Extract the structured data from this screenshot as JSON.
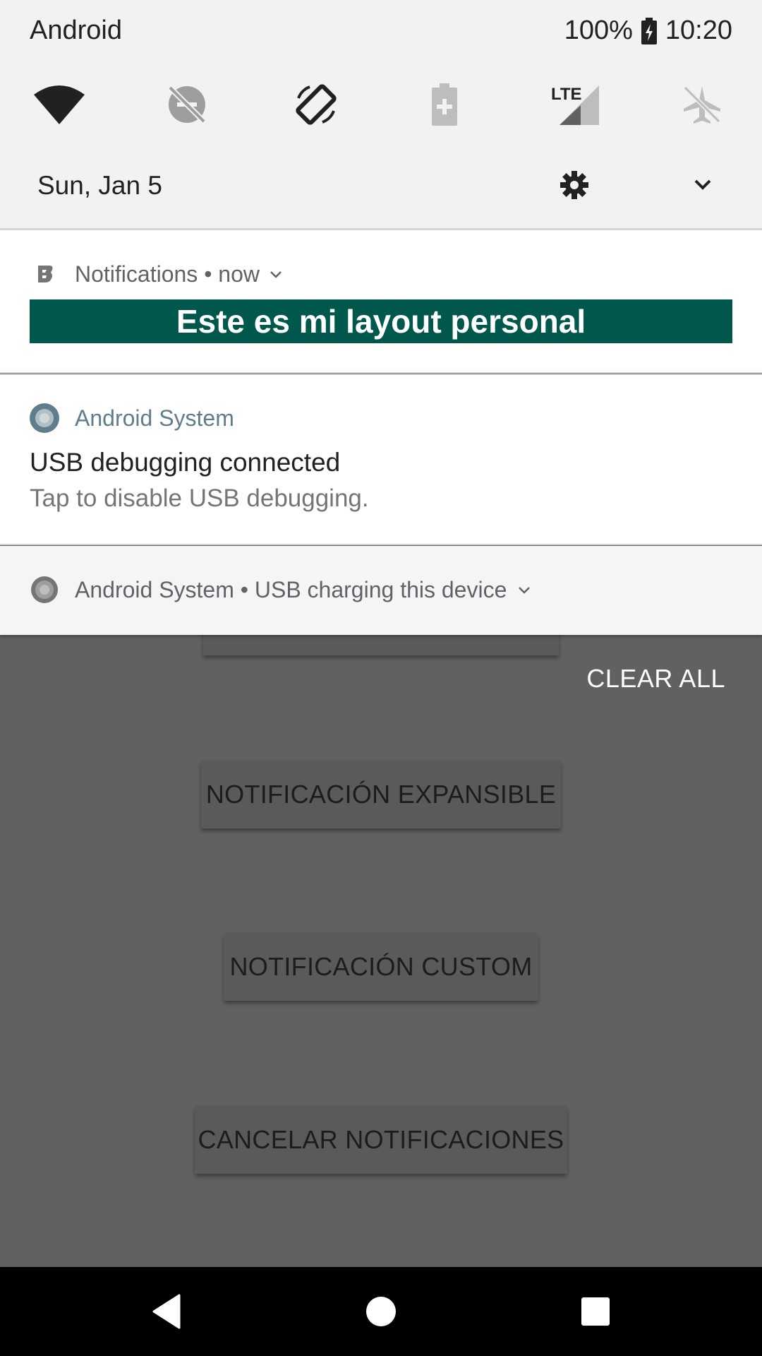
{
  "status_bar": {
    "carrier": "Android",
    "battery": "100%",
    "time": "10:20"
  },
  "quick_settings": {
    "tiles": [
      {
        "icon": "wifi-icon"
      },
      {
        "icon": "do-not-disturb-off-icon"
      },
      {
        "icon": "auto-rotate-icon"
      },
      {
        "icon": "battery-saver-icon"
      },
      {
        "icon": "lte-signal-icon",
        "text": "LTE"
      },
      {
        "icon": "airplane-mode-icon"
      }
    ],
    "date": "Sun, Jan 5"
  },
  "notifications": [
    {
      "app": "Notifications",
      "time": "now",
      "banner_text": "Este es mi layout personal",
      "banner_color": "#00574b"
    },
    {
      "app": "Android System",
      "title": "USB debugging connected",
      "text": "Tap to disable USB debugging."
    },
    {
      "app": "Android System",
      "summary": "USB charging this device"
    }
  ],
  "clear_all": "CLEAR ALL",
  "app_buttons": {
    "expansible": "NOTIFICACIÓN EXPANSIBLE",
    "custom": "NOTIFICACIÓN CUSTOM",
    "cancel": "CANCELAR NOTIFICACIONES"
  },
  "colors": {
    "scrim": "#616161",
    "shade": "#f2f2f2",
    "accent": "#00574b"
  }
}
